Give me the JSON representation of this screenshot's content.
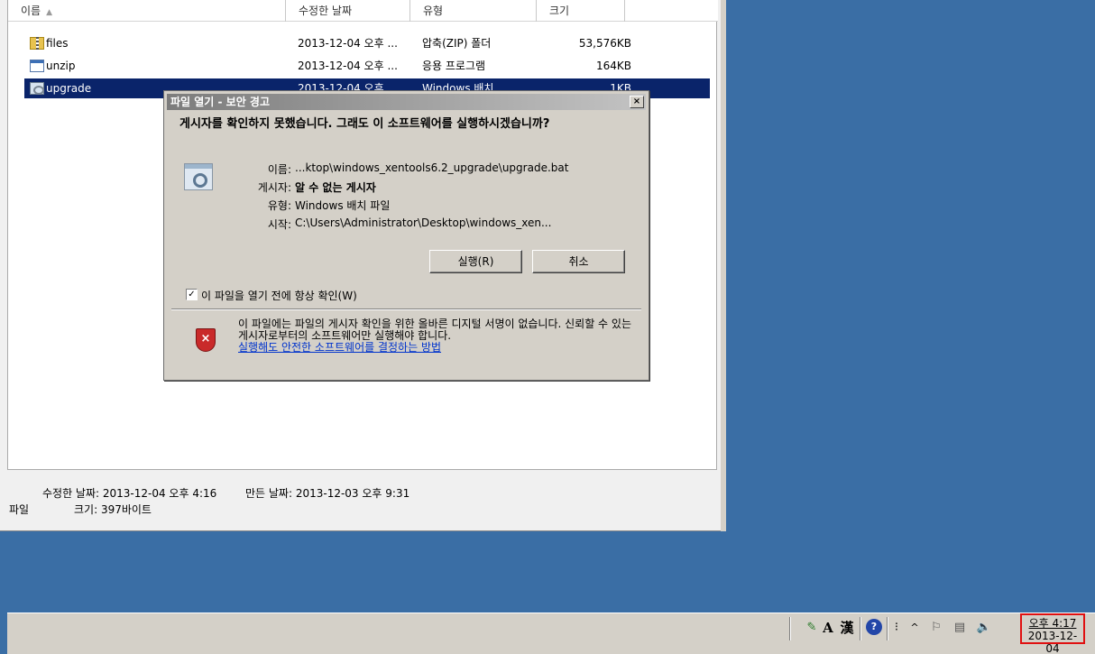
{
  "explorer": {
    "columns": [
      {
        "label": "이름",
        "sort_icon": "sort-ascending-icon"
      },
      {
        "label": "수정한 날짜"
      },
      {
        "label": "유형"
      },
      {
        "label": "크기"
      }
    ],
    "files": [
      {
        "icon": "zip-folder-icon",
        "name": "files",
        "date": "2013-12-04 오후 ...",
        "type": "압축(ZIP) 폴더",
        "size": "53,576KB"
      },
      {
        "icon": "application-icon",
        "name": "unzip",
        "date": "2013-12-04 오후 ...",
        "type": "응용 프로그램",
        "size": "164KB"
      },
      {
        "icon": "batch-file-icon",
        "name": "upgrade",
        "date": "2013-12-04 오후",
        "type": "Windows 배치",
        "size": "1KB",
        "selected": true
      }
    ],
    "details": {
      "modified": "수정한 날짜: 2013-12-04 오후 4:16",
      "created": "만든 날짜: 2013-12-03 오후 9:31",
      "kind": "파일",
      "size": "크기: 397바이트"
    }
  },
  "dialog": {
    "title": "파일 열기 - 보안 경고",
    "close_label": "×",
    "question": "게시자를 확인하지 못했습니다. 그래도 이 소프트웨어를 실행하시겠습니까?",
    "fields": [
      {
        "label": "이름:",
        "value": "...ktop\\windows_xentools6.2_upgrade\\upgrade.bat"
      },
      {
        "label": "게시자:",
        "value": "알 수 없는 게시자"
      },
      {
        "label": "유형:",
        "value": "Windows 배치 파일"
      },
      {
        "label": "시작:",
        "value": "C:\\Users\\Administrator\\Desktop\\windows_xen..."
      }
    ],
    "run_button": "실행(R)",
    "cancel_button": "취소",
    "checkbox": {
      "label": "이 파일을 열기 전에 항상 확인(W)",
      "checked": true,
      "mark": "✓"
    },
    "warning": "이 파일에는 파일의 게시자 확인을 위한 올바른 디지털 서명이 없습니다. 신뢰할 수 있는 게시자로부터의 소프트웨어만 실행해야 합니다.",
    "warning_link": "실행해도 안전한 소프트웨어를 결정하는 방법",
    "shield_mark": "×"
  },
  "taskbar": {
    "tray": {
      "ime_icon_glyph": "✎",
      "ime_mode": "A",
      "hanja": "漢",
      "help_glyph": "?",
      "menu_glyph": "⁝",
      "expand_glyph": "^",
      "flag_glyph": "⚐",
      "network_glyph": "▤",
      "volume_glyph": "🔈"
    },
    "clock_time": "오후 4:17",
    "clock_date": "2013-12-04"
  }
}
